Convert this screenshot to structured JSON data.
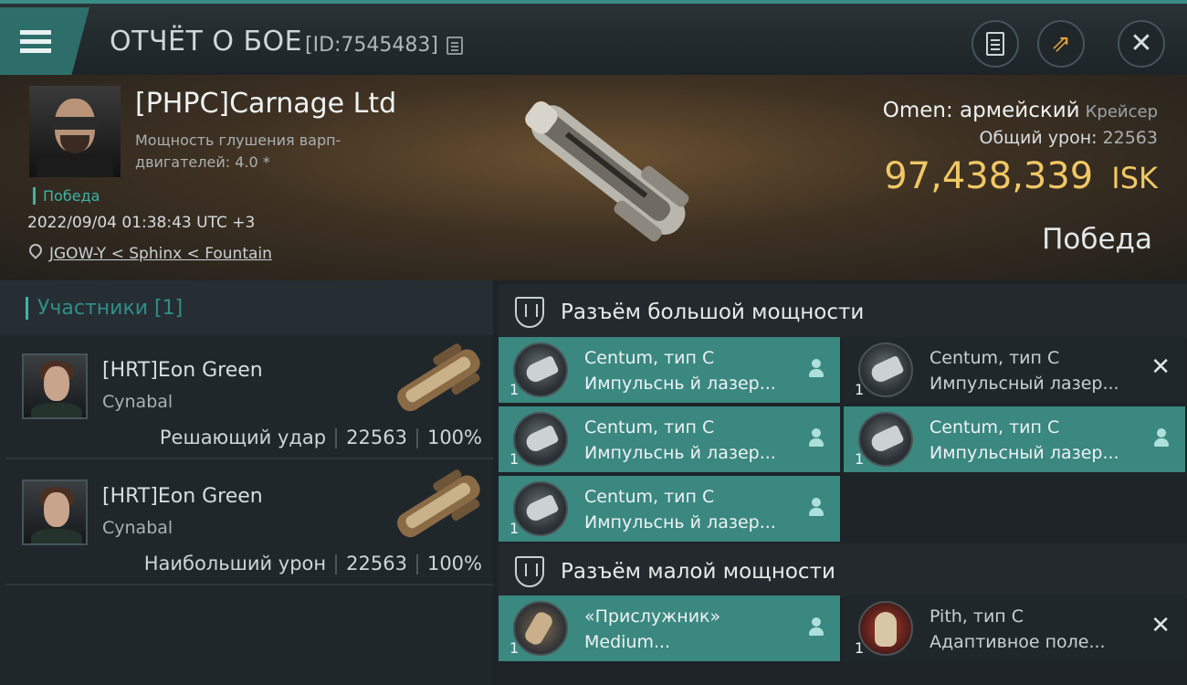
{
  "header": {
    "title": "ОТЧЁТ О БОЕ",
    "report_id": "[ID:7545483]",
    "buttons": [
      "clipboard-icon",
      "export-icon",
      "close-icon"
    ]
  },
  "victim": {
    "corp_name": "[PHPC]Carnage Ltd",
    "warp_strength": "Мощность глушения варп-двигателей: 4.0 *",
    "result_small": "Победа",
    "datetime": "2022/09/04 01:38:43 UTC +3",
    "location": "JGOW-Y < Sphinx < Fountain",
    "ship_name": "Omen: армейский",
    "ship_class": "Крейсер",
    "damage_label": "Общий урон:",
    "damage_value": "22563",
    "isk_value": "97,438,339",
    "isk_currency": "ISK",
    "result_big": "Победа"
  },
  "participants": {
    "title": "Участники [1]",
    "rows": [
      {
        "name": "[HRT]Eon Green",
        "ship": "Cynabal",
        "role": "Решающий удар",
        "damage": "22563",
        "percent": "100%"
      },
      {
        "name": "[HRT]Eon Green",
        "ship": "Cynabal",
        "role": "Наибольший урон",
        "damage": "22563",
        "percent": "100%"
      }
    ]
  },
  "high_slots": {
    "title": "Разъём большой мощности",
    "modules": [
      {
        "qty": "1",
        "name": "Centum, тип C",
        "sub": "Импульснь й лазер...",
        "state": "active",
        "icon": "pulse-laser-icon",
        "status_icon": "person-icon"
      },
      {
        "qty": "1",
        "name": "Centum, тип C",
        "sub": "Импульсный лазер...",
        "state": "dark",
        "icon": "pulse-laser-icon",
        "status_icon": "destroyed-x-icon"
      },
      {
        "qty": "1",
        "name": "Centum, тип C",
        "sub": "Импульснь й лазер...",
        "state": "active",
        "icon": "pulse-laser-icon",
        "status_icon": "person-icon"
      },
      {
        "qty": "1",
        "name": "Centum, тип C",
        "sub": "Импульсный лазер...",
        "state": "active",
        "icon": "pulse-laser-icon",
        "status_icon": "person-icon"
      },
      {
        "qty": "1",
        "name": "Centum, тип C",
        "sub": "Импульснь й лазер...",
        "state": "active",
        "icon": "pulse-laser-icon",
        "status_icon": "person-icon"
      }
    ]
  },
  "low_slots": {
    "title": "Разъём малой мощности",
    "modules": [
      {
        "qty": "1",
        "name": "«Прислужник»",
        "sub": "Medium...",
        "state": "active",
        "icon": "armor-repairer-icon",
        "status_icon": "person-icon"
      },
      {
        "qty": "1",
        "name": "Pith, тип C",
        "sub": "Адаптивное поле...",
        "state": "dark",
        "icon": "hardener-icon",
        "status_icon": "destroyed-x-icon"
      }
    ]
  },
  "colors": {
    "accent": "#3a8880",
    "isk": "#f0c765",
    "victory": "#3fb3a8"
  }
}
